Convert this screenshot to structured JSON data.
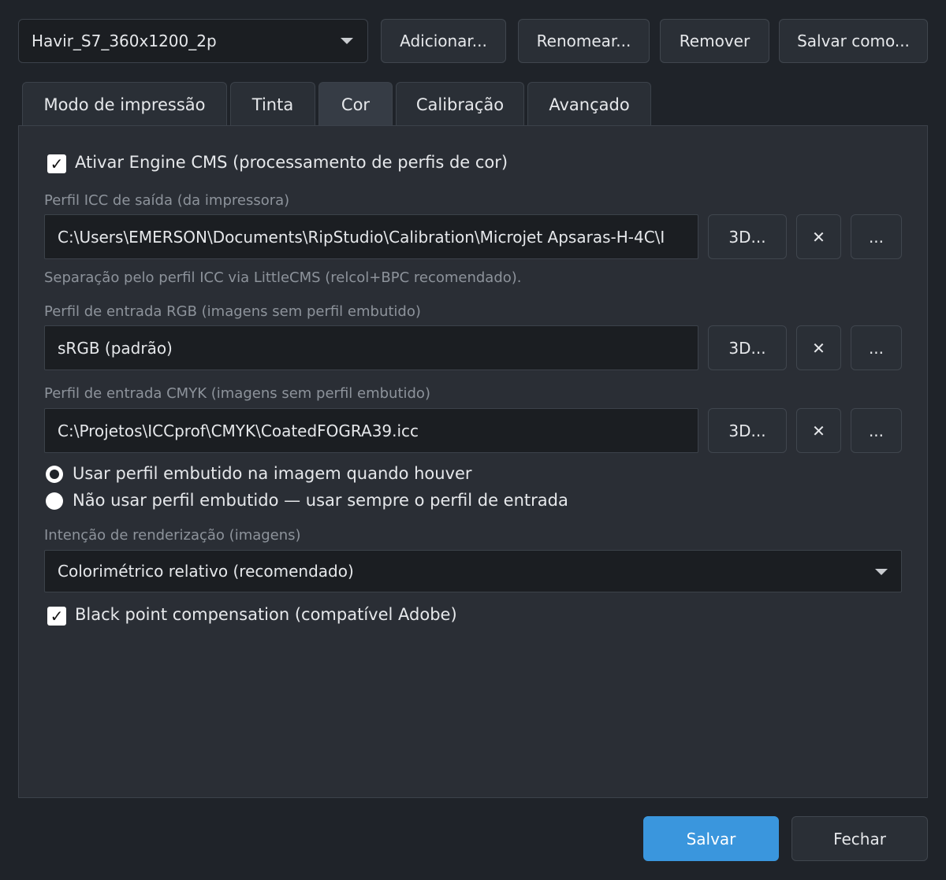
{
  "profile_selector": {
    "value": "Havir_S7_360x1200_2p"
  },
  "toolbar": {
    "add_label": "Adicionar...",
    "rename_label": "Renomear...",
    "remove_label": "Remover",
    "save_as_label": "Salvar como..."
  },
  "tabs": [
    {
      "label": "Modo de impressão",
      "active": false
    },
    {
      "label": "Tinta",
      "active": false
    },
    {
      "label": "Cor",
      "active": true
    },
    {
      "label": "Calibração",
      "active": false
    },
    {
      "label": "Avançado",
      "active": false
    }
  ],
  "cms": {
    "enable_label": "Ativar Engine CMS (processamento de perfis de cor)",
    "enable_checked": true,
    "output": {
      "caption": "Perfil ICC de saída (da impressora)",
      "value": "C:\\Users\\EMERSON\\Documents\\RipStudio\\Calibration\\Microjet Apsaras-H-4C\\I",
      "hint": "Separação pelo perfil ICC via LittleCMS (relcol+BPC recomendado)."
    },
    "rgb": {
      "caption": "Perfil de entrada RGB (imagens sem perfil embutido)",
      "value": "sRGB (padrão)"
    },
    "cmyk": {
      "caption": "Perfil de entrada CMYK (imagens sem perfil embutido)",
      "value": "C:\\Projetos\\ICCprof\\CMYK\\CoatedFOGRA39.icc"
    },
    "buttons": {
      "view3d": "3D...",
      "clear": "✕",
      "browse": "..."
    },
    "embedded_options": [
      {
        "label": "Usar perfil embutido na imagem quando houver",
        "selected": true
      },
      {
        "label": "Não usar perfil embutido — usar sempre o perfil de entrada",
        "selected": false
      }
    ],
    "intent": {
      "caption": "Intenção de renderização (imagens)",
      "value": "Colorimétrico relativo (recomendado)"
    },
    "bpc_label": "Black point compensation (compatível Adobe)",
    "bpc_checked": true
  },
  "footer": {
    "save_label": "Salvar",
    "close_label": "Fechar"
  },
  "colors": {
    "primary": "#3a96dd",
    "background": "#1f2329",
    "panel": "#2a2e35"
  }
}
